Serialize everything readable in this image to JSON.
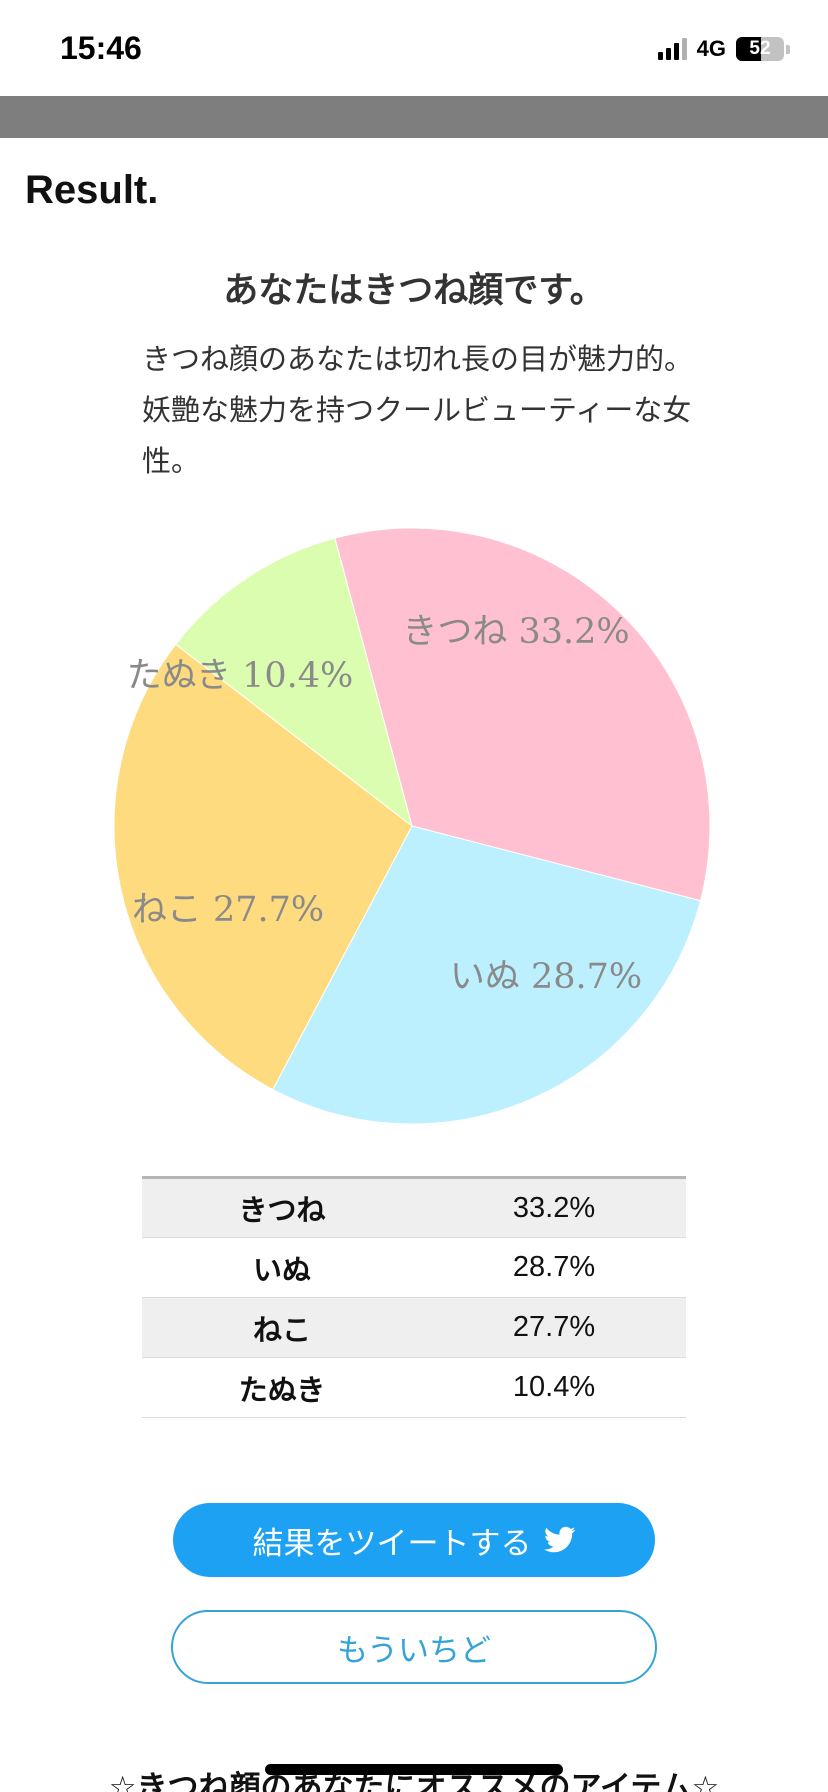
{
  "status_bar": {
    "time": "15:46",
    "network": "4G",
    "battery_level": "52",
    "battery_fraction": 0.52
  },
  "section_heading": "Result.",
  "result": {
    "title": "あなたはきつね顔です。",
    "description": "きつね顔のあなたは切れ長の目が魅力的。妖艶な魅力を持つクールビューティーな女性。"
  },
  "chart_data": {
    "type": "pie",
    "start_angle_deg": -105,
    "direction": "clockwise",
    "slices": [
      {
        "label": "きつね 33.2%",
        "name": "きつね",
        "value": 33.2,
        "color": "#ffc0d1"
      },
      {
        "label": "いぬ 28.7%",
        "name": "いぬ",
        "value": 28.7,
        "color": "#bcf0fe"
      },
      {
        "label": "ねこ 27.7%",
        "name": "ねこ",
        "value": 27.7,
        "color": "#ffdb80"
      },
      {
        "label": "たぬき 10.4%",
        "name": "たぬき",
        "value": 10.4,
        "color": "#dbfdb0"
      }
    ],
    "label_color": "#8a8a8a"
  },
  "table": {
    "rows": [
      {
        "name": "きつね",
        "percent": "33.2%"
      },
      {
        "name": "いぬ",
        "percent": "28.7%"
      },
      {
        "name": "ねこ",
        "percent": "27.7%"
      },
      {
        "name": "たぬき",
        "percent": "10.4%"
      }
    ]
  },
  "buttons": {
    "tweet_label": "結果をツイートする",
    "tweet_icon": "twitter-bird-icon",
    "retry_label": "もういちど"
  },
  "recommend_heading": "☆きつね顔のあなたにオススメのアイテム☆",
  "colors": {
    "accent": "#1da1f2",
    "retry_outline": "#35a3d8",
    "header_bar": "#7e7e7e"
  }
}
